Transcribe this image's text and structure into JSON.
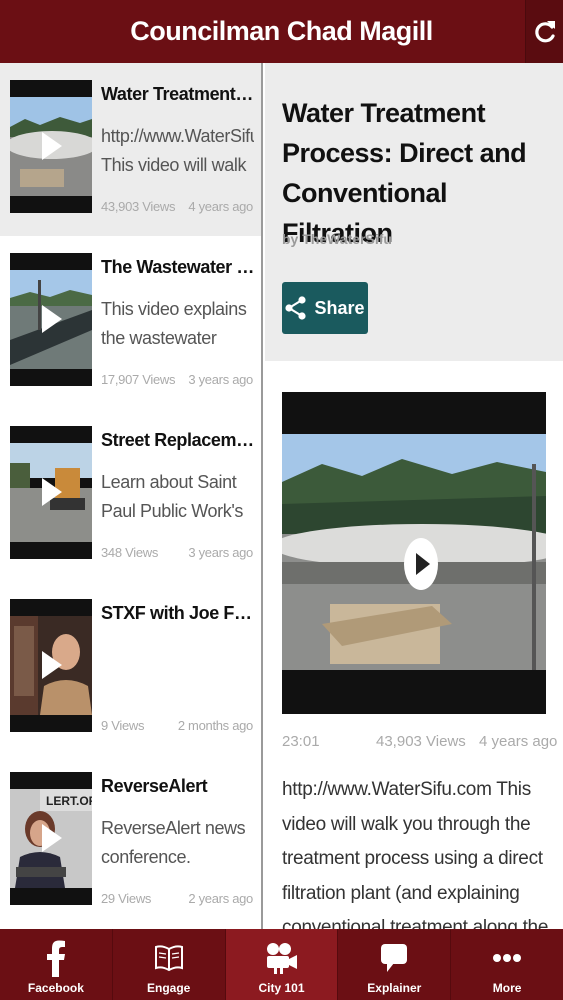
{
  "header": {
    "title": "Councilman Chad Magill",
    "refresh_icon": "refresh-icon"
  },
  "videos": [
    {
      "title": "Water Treatment Pro...",
      "desc": "http://www.WaterSifu.com This video will walk you",
      "views": "43,903 Views",
      "age": "4 years ago"
    },
    {
      "title": "The Wastewater Tre...",
      "desc": "This video explains the wastewater treatment",
      "views": "17,907 Views",
      "age": "3 years ago"
    },
    {
      "title": "Street Replacement ...",
      "desc": "Learn about Saint Paul Public Work's",
      "views": "348 Views",
      "age": "3 years ago"
    },
    {
      "title": "STXF with Joe Flore...",
      "desc": "",
      "views": "9 Views",
      "age": "2 months ago"
    },
    {
      "title": "ReverseAlert",
      "desc": "ReverseAlert news conference.",
      "views": "29 Views",
      "age": "2 years ago"
    }
  ],
  "detail": {
    "title": "Water Treatment Process: Direct and Conventional Filtration",
    "by": "by  TheWaterSifu",
    "share_label": "Share",
    "duration": "23:01",
    "views": "43,903 Views",
    "age": "4 years ago",
    "description": "http://www.WaterSifu.com This video will walk you through the treatment process using a direct filtration plant (and explaining conventional treatment along the way)."
  },
  "tabs": [
    {
      "label": "Facebook",
      "icon": "facebook-icon"
    },
    {
      "label": "Engage",
      "icon": "book-icon"
    },
    {
      "label": "City 101",
      "icon": "video-camera-icon",
      "active": true
    },
    {
      "label": "Explainer",
      "icon": "speech-bubble-icon"
    },
    {
      "label": "More",
      "icon": "more-dots-icon"
    }
  ],
  "colors": {
    "brand": "#6b0f14",
    "active_tab": "#8c1a20",
    "share": "#1a5a5e"
  }
}
